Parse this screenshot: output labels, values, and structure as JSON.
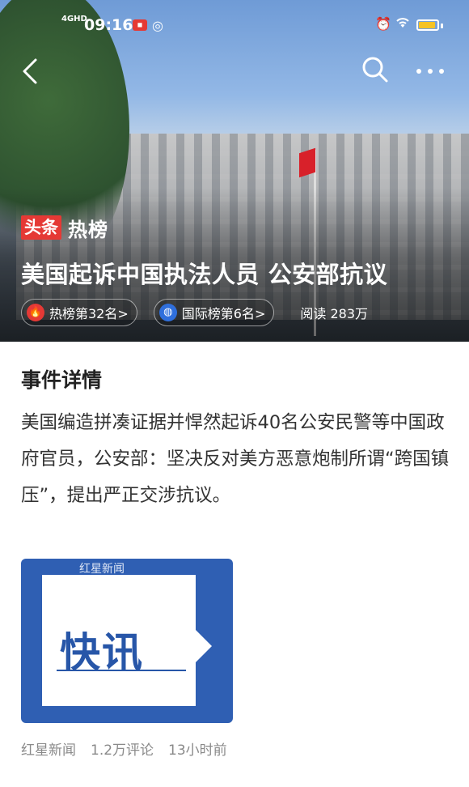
{
  "status_bar": {
    "network": "4GHD",
    "time": "09:16",
    "battery_level": 0.9,
    "battery_color": "#f6c324"
  },
  "nav": {
    "back_icon": "chevron-left-icon",
    "search_icon": "search-icon",
    "more_icon": "more-icon"
  },
  "brand": {
    "logo_text": "头条",
    "title": "热榜"
  },
  "hero": {
    "headline": "美国起诉中国执法人员 公安部抗议"
  },
  "chips": [
    {
      "icon": "fire-icon",
      "label": "热榜第32名>"
    },
    {
      "icon": "globe-icon",
      "label": "国际榜第6名>"
    }
  ],
  "reads": "阅读 283万",
  "section": {
    "title": "事件详情",
    "description": "美国编造拼凑证据并悍然起诉40名公安民警等中国政府官员，公安部：坚决反对美方恶意炮制所谓“跨国镇压”，提出严正交涉抗议。"
  },
  "news_card": {
    "brand": "红星新闻",
    "headline": "快讯",
    "bg_color": "#2f5fb3"
  },
  "meta": {
    "source": "红星新闻",
    "comments": "1.2万评论",
    "time": "13小时前"
  }
}
